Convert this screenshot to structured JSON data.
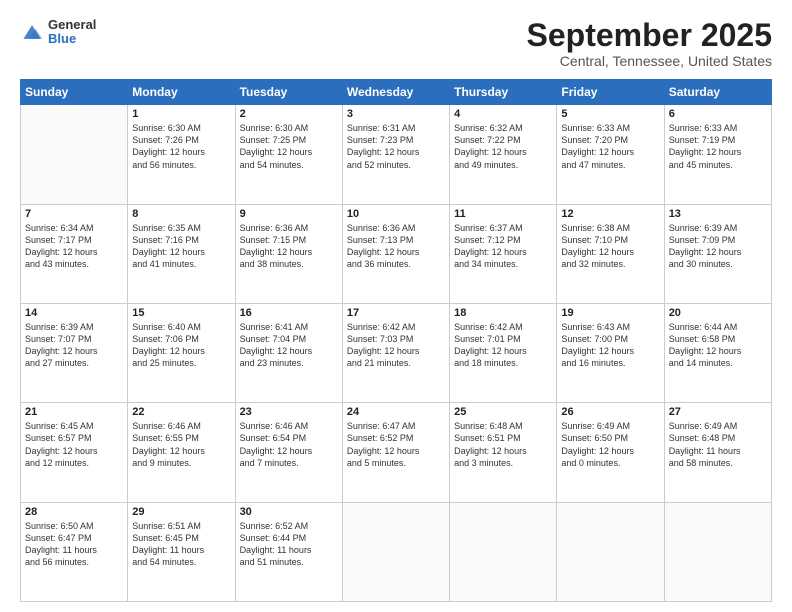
{
  "logo": {
    "general": "General",
    "blue": "Blue"
  },
  "header": {
    "title": "September 2025",
    "subtitle": "Central, Tennessee, United States"
  },
  "weekdays": [
    "Sunday",
    "Monday",
    "Tuesday",
    "Wednesday",
    "Thursday",
    "Friday",
    "Saturday"
  ],
  "weeks": [
    [
      {
        "day": "",
        "info": ""
      },
      {
        "day": "1",
        "info": "Sunrise: 6:30 AM\nSunset: 7:26 PM\nDaylight: 12 hours\nand 56 minutes."
      },
      {
        "day": "2",
        "info": "Sunrise: 6:30 AM\nSunset: 7:25 PM\nDaylight: 12 hours\nand 54 minutes."
      },
      {
        "day": "3",
        "info": "Sunrise: 6:31 AM\nSunset: 7:23 PM\nDaylight: 12 hours\nand 52 minutes."
      },
      {
        "day": "4",
        "info": "Sunrise: 6:32 AM\nSunset: 7:22 PM\nDaylight: 12 hours\nand 49 minutes."
      },
      {
        "day": "5",
        "info": "Sunrise: 6:33 AM\nSunset: 7:20 PM\nDaylight: 12 hours\nand 47 minutes."
      },
      {
        "day": "6",
        "info": "Sunrise: 6:33 AM\nSunset: 7:19 PM\nDaylight: 12 hours\nand 45 minutes."
      }
    ],
    [
      {
        "day": "7",
        "info": "Sunrise: 6:34 AM\nSunset: 7:17 PM\nDaylight: 12 hours\nand 43 minutes."
      },
      {
        "day": "8",
        "info": "Sunrise: 6:35 AM\nSunset: 7:16 PM\nDaylight: 12 hours\nand 41 minutes."
      },
      {
        "day": "9",
        "info": "Sunrise: 6:36 AM\nSunset: 7:15 PM\nDaylight: 12 hours\nand 38 minutes."
      },
      {
        "day": "10",
        "info": "Sunrise: 6:36 AM\nSunset: 7:13 PM\nDaylight: 12 hours\nand 36 minutes."
      },
      {
        "day": "11",
        "info": "Sunrise: 6:37 AM\nSunset: 7:12 PM\nDaylight: 12 hours\nand 34 minutes."
      },
      {
        "day": "12",
        "info": "Sunrise: 6:38 AM\nSunset: 7:10 PM\nDaylight: 12 hours\nand 32 minutes."
      },
      {
        "day": "13",
        "info": "Sunrise: 6:39 AM\nSunset: 7:09 PM\nDaylight: 12 hours\nand 30 minutes."
      }
    ],
    [
      {
        "day": "14",
        "info": "Sunrise: 6:39 AM\nSunset: 7:07 PM\nDaylight: 12 hours\nand 27 minutes."
      },
      {
        "day": "15",
        "info": "Sunrise: 6:40 AM\nSunset: 7:06 PM\nDaylight: 12 hours\nand 25 minutes."
      },
      {
        "day": "16",
        "info": "Sunrise: 6:41 AM\nSunset: 7:04 PM\nDaylight: 12 hours\nand 23 minutes."
      },
      {
        "day": "17",
        "info": "Sunrise: 6:42 AM\nSunset: 7:03 PM\nDaylight: 12 hours\nand 21 minutes."
      },
      {
        "day": "18",
        "info": "Sunrise: 6:42 AM\nSunset: 7:01 PM\nDaylight: 12 hours\nand 18 minutes."
      },
      {
        "day": "19",
        "info": "Sunrise: 6:43 AM\nSunset: 7:00 PM\nDaylight: 12 hours\nand 16 minutes."
      },
      {
        "day": "20",
        "info": "Sunrise: 6:44 AM\nSunset: 6:58 PM\nDaylight: 12 hours\nand 14 minutes."
      }
    ],
    [
      {
        "day": "21",
        "info": "Sunrise: 6:45 AM\nSunset: 6:57 PM\nDaylight: 12 hours\nand 12 minutes."
      },
      {
        "day": "22",
        "info": "Sunrise: 6:46 AM\nSunset: 6:55 PM\nDaylight: 12 hours\nand 9 minutes."
      },
      {
        "day": "23",
        "info": "Sunrise: 6:46 AM\nSunset: 6:54 PM\nDaylight: 12 hours\nand 7 minutes."
      },
      {
        "day": "24",
        "info": "Sunrise: 6:47 AM\nSunset: 6:52 PM\nDaylight: 12 hours\nand 5 minutes."
      },
      {
        "day": "25",
        "info": "Sunrise: 6:48 AM\nSunset: 6:51 PM\nDaylight: 12 hours\nand 3 minutes."
      },
      {
        "day": "26",
        "info": "Sunrise: 6:49 AM\nSunset: 6:50 PM\nDaylight: 12 hours\nand 0 minutes."
      },
      {
        "day": "27",
        "info": "Sunrise: 6:49 AM\nSunset: 6:48 PM\nDaylight: 11 hours\nand 58 minutes."
      }
    ],
    [
      {
        "day": "28",
        "info": "Sunrise: 6:50 AM\nSunset: 6:47 PM\nDaylight: 11 hours\nand 56 minutes."
      },
      {
        "day": "29",
        "info": "Sunrise: 6:51 AM\nSunset: 6:45 PM\nDaylight: 11 hours\nand 54 minutes."
      },
      {
        "day": "30",
        "info": "Sunrise: 6:52 AM\nSunset: 6:44 PM\nDaylight: 11 hours\nand 51 minutes."
      },
      {
        "day": "",
        "info": ""
      },
      {
        "day": "",
        "info": ""
      },
      {
        "day": "",
        "info": ""
      },
      {
        "day": "",
        "info": ""
      }
    ]
  ]
}
